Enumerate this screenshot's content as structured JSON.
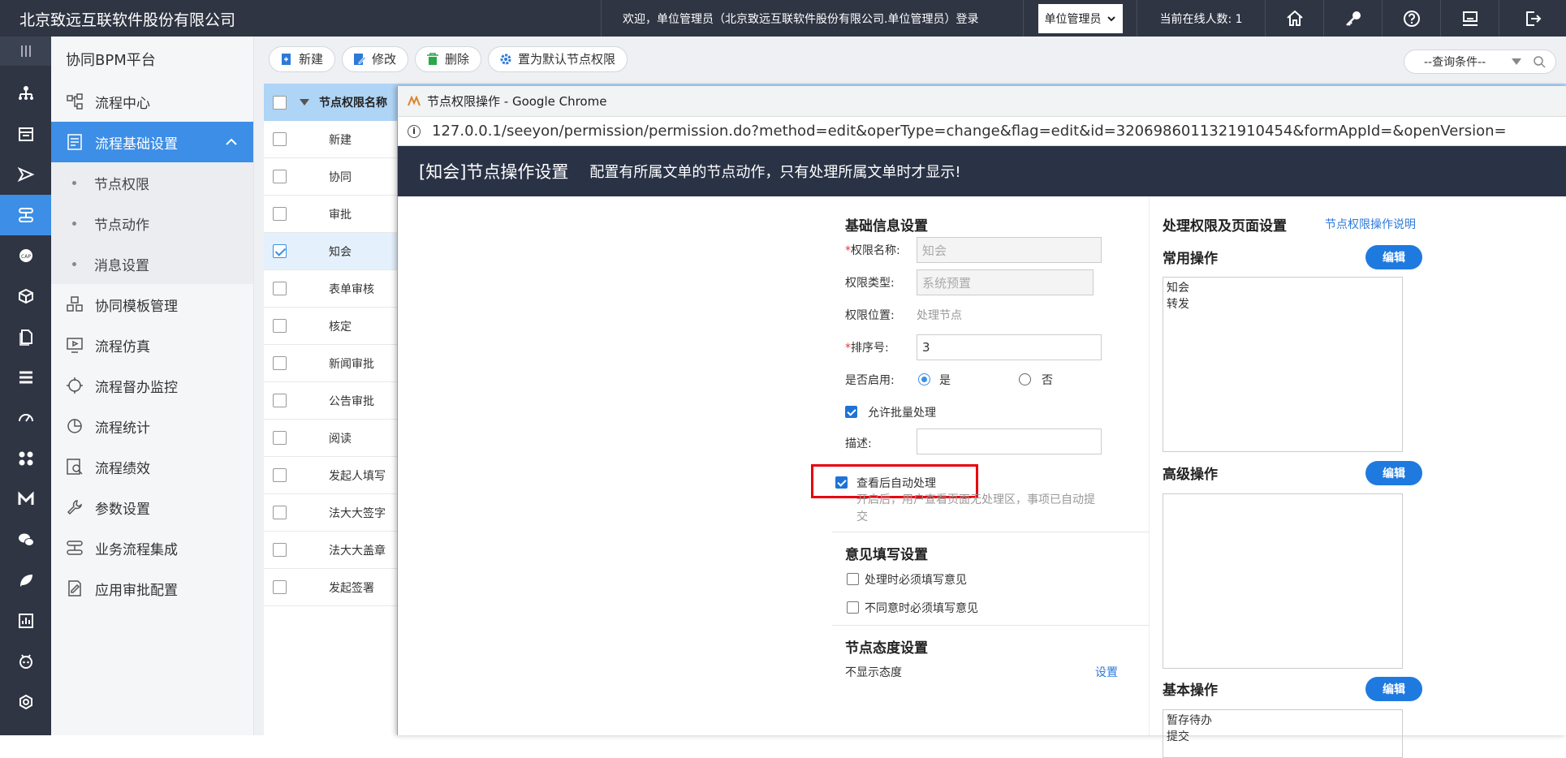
{
  "header": {
    "company": "北京致远互联软件股份有限公司",
    "welcome": "欢迎，单位管理员（北京致远互联软件股份有限公司.单位管理员）登录",
    "role": "单位管理员",
    "online": "当前在线人数: 1"
  },
  "sidebar": {
    "title": "协同BPM平台",
    "items": [
      {
        "label": "流程中心"
      },
      {
        "label": "流程基础设置"
      },
      {
        "label": "节点权限"
      },
      {
        "label": "节点动作"
      },
      {
        "label": "消息设置"
      },
      {
        "label": "协同模板管理"
      },
      {
        "label": "流程仿真"
      },
      {
        "label": "流程督办监控"
      },
      {
        "label": "流程统计"
      },
      {
        "label": "流程绩效"
      },
      {
        "label": "参数设置"
      },
      {
        "label": "业务流程集成"
      },
      {
        "label": "应用审批配置"
      }
    ]
  },
  "toolbar": {
    "new": "新建",
    "edit": "修改",
    "delete": "删除",
    "default": "置为默认节点权限",
    "query": "--查询条件--"
  },
  "table": {
    "header": "节点权限名称",
    "rows": [
      "新建",
      "协同",
      "审批",
      "知会",
      "表单审核",
      "核定",
      "新闻审批",
      "公告审批",
      "阅读",
      "发起人填写",
      "法大大签字",
      "法大大盖章",
      "发起签署"
    ]
  },
  "popup": {
    "window_title": "节点权限操作 - Google Chrome",
    "url": "127.0.0.1/seeyon/permission/permission.do?method=edit&operType=change&flag=edit&id=3206986011321910454&formAppId=&openVersion=",
    "title": "[知会]节点操作设置",
    "subtitle": "配置有所属文单的节点动作，只有处理所属文单时才显示!",
    "basic": {
      "section": "基础信息设置",
      "name_label": "权限名称:",
      "name_value": "知会",
      "type_label": "权限类型:",
      "type_value": "系统预置",
      "pos_label": "权限位置:",
      "pos_value": "处理节点",
      "order_label": "排序号:",
      "order_value": "3",
      "enable_label": "是否启用:",
      "yes": "是",
      "no": "否",
      "batch": "允许批量处理",
      "desc_label": "描述:",
      "auto": "查看后自动处理",
      "auto_hint": "开启后，用户查看页面无处理区，事项已自动提交"
    },
    "opinion": {
      "section": "意见填写设置",
      "must": "处理时必须填写意见",
      "must_disagree": "不同意时必须填写意见"
    },
    "attitude": {
      "section": "节点态度设置",
      "value": "不显示态度",
      "set": "设置"
    },
    "right": {
      "section": "处理权限及页面设置",
      "help": "节点权限操作说明",
      "common": "常用操作",
      "common_items": [
        "知会",
        "转发"
      ],
      "advanced": "高级操作",
      "basic": "基本操作",
      "basic_items": [
        "暂存待办",
        "提交"
      ],
      "edit": "编辑"
    }
  }
}
